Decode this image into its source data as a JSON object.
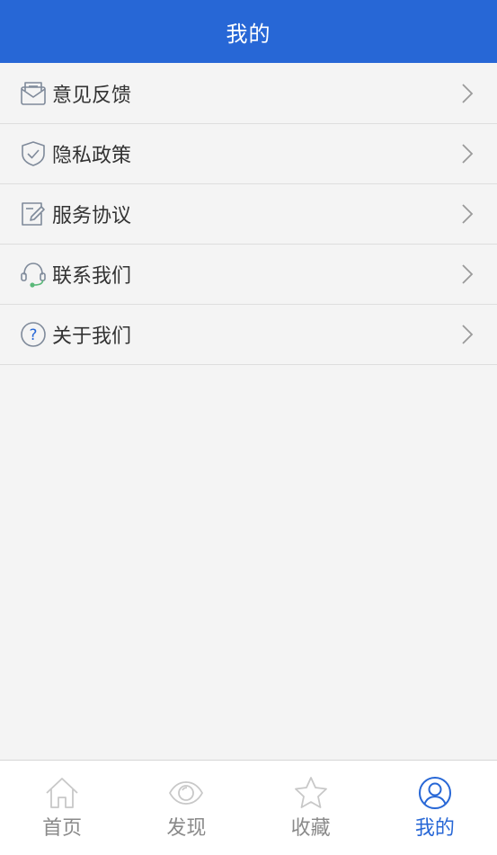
{
  "header": {
    "title": "我的"
  },
  "menu": [
    {
      "label": "意见反馈",
      "icon": "feedback-envelope-icon"
    },
    {
      "label": "隐私政策",
      "icon": "shield-check-icon"
    },
    {
      "label": "服务协议",
      "icon": "document-edit-icon"
    },
    {
      "label": "联系我们",
      "icon": "headset-icon"
    },
    {
      "label": "关于我们",
      "icon": "question-circle-icon"
    }
  ],
  "tabbar": {
    "active": "我的",
    "tabs": [
      {
        "label": "首页",
        "icon": "home-icon"
      },
      {
        "label": "发现",
        "icon": "eye-icon"
      },
      {
        "label": "收藏",
        "icon": "star-icon"
      },
      {
        "label": "我的",
        "icon": "user-icon"
      }
    ]
  },
  "colors": {
    "primary": "#2767d6",
    "background": "#f4f4f4",
    "text": "#333333",
    "inactive_tab": "#8a8a8a",
    "icon_gray": "#7f8a9a",
    "headset_accent": "#5bb97a"
  }
}
